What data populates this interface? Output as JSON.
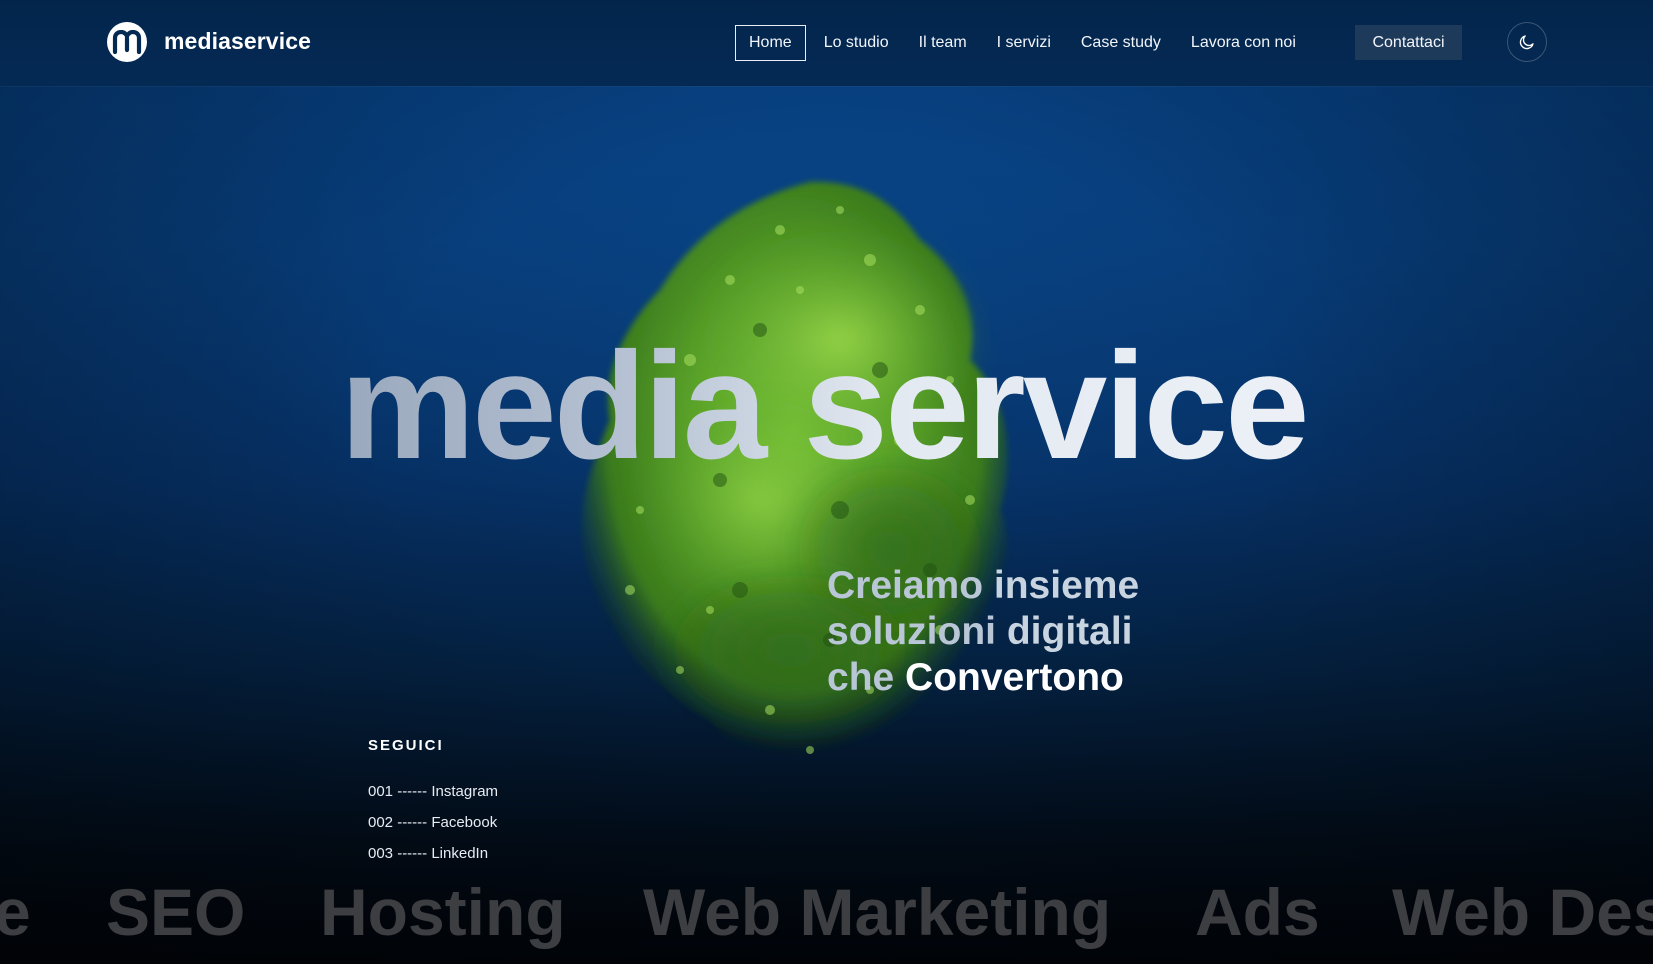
{
  "brand": {
    "logo_letter": "m",
    "name": "mediaservice"
  },
  "nav": {
    "items": [
      {
        "label": "Home",
        "active": true
      },
      {
        "label": "Lo studio",
        "active": false
      },
      {
        "label": "Il team",
        "active": false
      },
      {
        "label": "I servizi",
        "active": false
      },
      {
        "label": "Case study",
        "active": false
      },
      {
        "label": "Lavora con noi",
        "active": false
      }
    ],
    "cta_label": "Contattaci",
    "theme_toggle_icon": "moon-icon"
  },
  "hero": {
    "title": "media service",
    "tagline": {
      "line1_part1": "Creiamo",
      "line1_part2": " insieme",
      "line2_part1": "soluzioni",
      "line2_part2": " digitali",
      "line3_part1": "che ",
      "line3_part2": "Convertono"
    }
  },
  "social": {
    "heading": "SEGUICI",
    "links": [
      {
        "label": "001 ------ Instagram"
      },
      {
        "label": "002 ------ Facebook"
      },
      {
        "label": "003 ------ LinkedIn"
      }
    ]
  },
  "marquee": {
    "items": [
      "e",
      "SEO",
      "Hosting",
      "Web Marketing",
      "Ads",
      "Web Des"
    ]
  },
  "colors": {
    "background_top": "#064184",
    "background_bottom": "#010409",
    "nav_background": "#03254c",
    "cta_background": "#1e3a5a",
    "marquee_text": "#3c3e42",
    "foliage": "#5fae2c"
  }
}
